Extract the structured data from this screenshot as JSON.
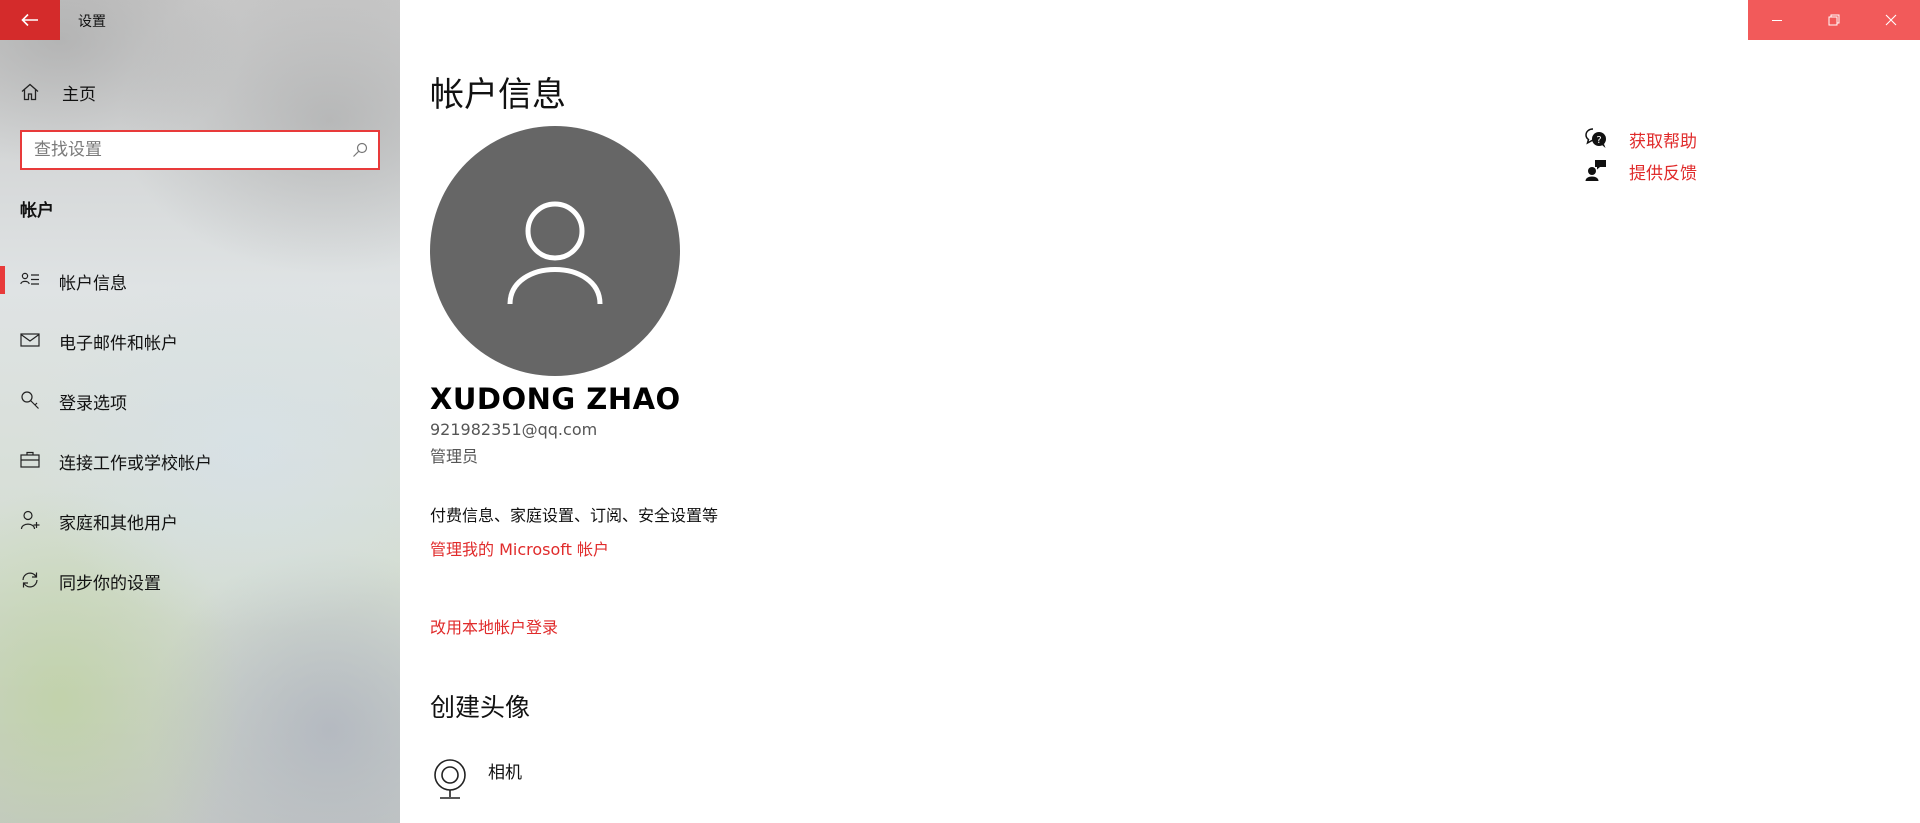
{
  "app": {
    "title": "设置"
  },
  "sidebar": {
    "home_label": "主页",
    "search_placeholder": "查找设置",
    "section_heading": "帐户",
    "items": [
      {
        "label": "帐户信息",
        "icon": "account-info-icon",
        "selected": true
      },
      {
        "label": "电子邮件和帐户",
        "icon": "mail-icon",
        "selected": false
      },
      {
        "label": "登录选项",
        "icon": "key-icon",
        "selected": false
      },
      {
        "label": "连接工作或学校帐户",
        "icon": "briefcase-icon",
        "selected": false
      },
      {
        "label": "家庭和其他用户",
        "icon": "person-add-icon",
        "selected": false
      },
      {
        "label": "同步你的设置",
        "icon": "sync-icon",
        "selected": false
      }
    ]
  },
  "main": {
    "page_title": "帐户信息",
    "user": {
      "name": "XUDONG ZHAO",
      "email": "921982351@qq.com",
      "role": "管理员"
    },
    "billing_text": "付费信息、家庭设置、订阅、安全设置等",
    "manage_link": "管理我的 Microsoft 帐户",
    "local_link": "改用本地帐户登录",
    "create_avatar_heading": "创建头像",
    "camera_label": "相机",
    "side_links": {
      "help": "获取帮助",
      "feedback": "提供反馈"
    }
  },
  "colors": {
    "accent": "#e02b2b",
    "back_button": "#d42b2b",
    "window_controls": "#f25a5a",
    "avatar_bg": "#666666"
  }
}
